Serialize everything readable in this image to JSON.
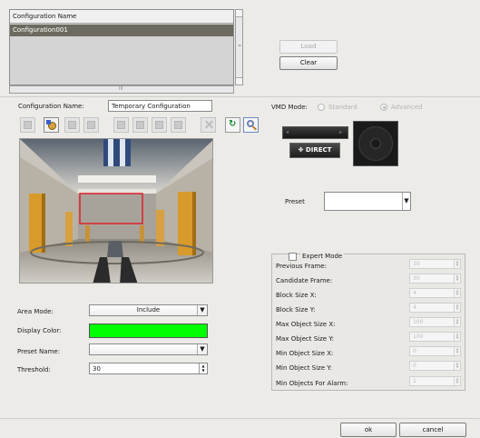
{
  "config_list": {
    "header": "Configuration Name",
    "items": [
      "Configuration001"
    ],
    "scroll_grip": "III"
  },
  "buttons": {
    "load": "Load",
    "clear": "Clear",
    "ok": "ok",
    "cancel": "cancel"
  },
  "form": {
    "config_name_label": "Configuration Name:",
    "config_name_value": "Temporary Configuration",
    "area_mode_label": "Area Mode:",
    "area_mode_value": "Include",
    "display_color_label": "Display Color:",
    "display_color": "#00ff00",
    "preset_name_label": "Preset Name:",
    "preset_name_value": "",
    "threshold_label": "Threshold:",
    "threshold_value": "30"
  },
  "vmd": {
    "label": "VMD Mode:",
    "standard": "Standard",
    "advanced": "Advanced",
    "selected": "Advanced",
    "direct_label": "DIRECT",
    "preset_label": "Preset",
    "preset_value": ""
  },
  "expert": {
    "title": "Expert Mode",
    "checked": false,
    "rows": [
      {
        "label": "Previous Frame:",
        "value": "30"
      },
      {
        "label": "Candidate Frame:",
        "value": "30"
      },
      {
        "label": "Block Size X:",
        "value": "4"
      },
      {
        "label": "Block Size Y:",
        "value": "4"
      },
      {
        "label": "Max Object Size X:",
        "value": "100"
      },
      {
        "label": "Max Object Size Y:",
        "value": "100"
      },
      {
        "label": "Min Object Size X:",
        "value": "0"
      },
      {
        "label": "Min Object Size Y:",
        "value": "0"
      },
      {
        "label": "Min Objects For Alarm:",
        "value": "1"
      }
    ]
  },
  "toolbar_icons": [
    "grid-icon",
    "brush-icon",
    "stamp-icon",
    "eraser-icon",
    "add-zone-icon",
    "add-zone-2-icon",
    "zone-edit-icon",
    "zone-edit-2-icon",
    "delete-icon",
    "refresh-icon",
    "zoom-icon"
  ],
  "colors": {
    "accent_selected_row": "#6d6b5f",
    "detection_box": "#e0202a"
  }
}
